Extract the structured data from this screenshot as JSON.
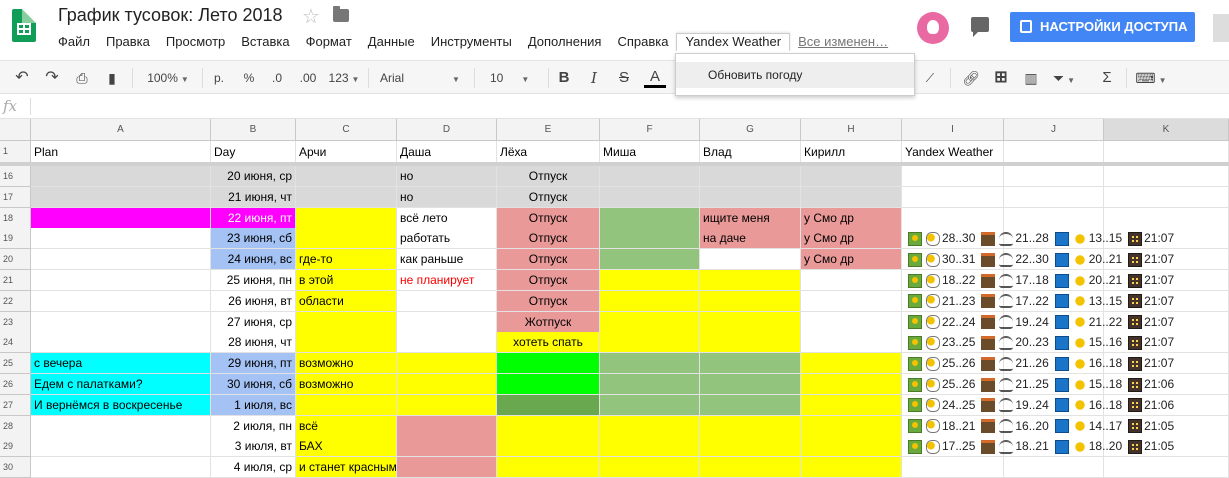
{
  "doc_title": "График тусовок: Лето 2018",
  "menu": [
    {
      "label": "Файл"
    },
    {
      "label": "Правка"
    },
    {
      "label": "Просмотр"
    },
    {
      "label": "Вставка"
    },
    {
      "label": "Формат"
    },
    {
      "label": "Данные"
    },
    {
      "label": "Инструменты"
    },
    {
      "label": "Дополнения"
    },
    {
      "label": "Справка"
    },
    {
      "label": "Yandex Weather"
    },
    {
      "label": "Все изменен…"
    }
  ],
  "share_label": "НАСТРОЙКИ ДОСТУПА",
  "dropdown_item": "Обновить погоду",
  "toolbar": {
    "zoom": "100%",
    "currency": "р.",
    "percent": "%",
    "dec_less": ".0",
    "dec_more": ".00",
    "format": "123",
    "font": "Arial",
    "font_size": "10",
    "bold": "B",
    "italic": "I",
    "strike": "S",
    "text_color": "A"
  },
  "formula_icon": "fx",
  "columns": [
    "A",
    "B",
    "C",
    "D",
    "E",
    "F",
    "G",
    "H",
    "I",
    "J",
    "K"
  ],
  "header_row": {
    "num": "1",
    "cells": [
      "Plan",
      "Day",
      "Арчи",
      "Даша",
      "Лёха",
      "Миша",
      "Влад",
      "Кирилл",
      "Yandex Weather",
      "",
      ""
    ]
  },
  "rows": [
    {
      "num": "16",
      "cells": [
        "",
        "20 июня, ср",
        "",
        "но",
        "Отпуск",
        "",
        "",
        "",
        ""
      ]
    },
    {
      "num": "17",
      "cells": [
        "",
        "21 июня, чт",
        "",
        "но",
        "Отпуск",
        "",
        "",
        "",
        ""
      ]
    },
    {
      "num": "18",
      "cells": [
        "",
        "22 июня, пт",
        "",
        "всё лето",
        "Отпуск",
        "",
        "ищите меня",
        "у Смо др",
        ""
      ]
    },
    {
      "num": "19",
      "cells": [
        "",
        "23 июня, сб",
        "",
        "работать",
        "Отпуск",
        "",
        "на даче",
        "у Смо др",
        ""
      ]
    },
    {
      "num": "20",
      "cells": [
        "",
        "24 июня, вс",
        "где-то",
        "как раньше",
        "Отпуск",
        "",
        "",
        "у Смо др",
        ""
      ]
    },
    {
      "num": "21",
      "cells": [
        "",
        "25 июня, пн",
        "в этой",
        "не планирует",
        "Отпуск",
        "",
        "",
        "",
        ""
      ]
    },
    {
      "num": "22",
      "cells": [
        "",
        "26 июня, вт",
        "области",
        "",
        "Отпуск",
        "",
        "",
        "",
        ""
      ]
    },
    {
      "num": "23",
      "cells": [
        "",
        "27 июня, ср",
        "",
        "",
        "Жотпуск",
        "",
        "",
        "",
        ""
      ]
    },
    {
      "num": "24",
      "cells": [
        "",
        "28 июня, чт",
        "",
        "",
        "хотеть спать",
        "",
        "",
        "",
        ""
      ]
    },
    {
      "num": "25",
      "cells": [
        "с вечера",
        "29 июня, пт",
        "возможно",
        "",
        "",
        "",
        "",
        "",
        ""
      ]
    },
    {
      "num": "26",
      "cells": [
        "Едем с палатками?",
        "30 июня, сб",
        "возможно",
        "",
        "",
        "",
        "",
        "",
        ""
      ]
    },
    {
      "num": "27",
      "cells": [
        "И вернёмся в воскресенье",
        "1 июля, вс",
        "",
        "",
        "",
        "",
        "",
        "",
        ""
      ]
    },
    {
      "num": "28",
      "cells": [
        "",
        "2 июля, пн",
        "всё",
        "",
        "",
        "",
        "",
        "",
        ""
      ]
    },
    {
      "num": "29",
      "cells": [
        "",
        "3 июля, вт",
        "БАХ",
        "",
        "",
        "",
        "",
        "",
        ""
      ]
    },
    {
      "num": "30",
      "cells": [
        "",
        "4 июля, ср",
        "и станет красным",
        "",
        "",
        "",
        "",
        "",
        ""
      ]
    }
  ],
  "weather": [
    {
      "row": "19",
      "t1": "28..30",
      "t2": "21..28",
      "t3": "13..15",
      "time": "21:07"
    },
    {
      "row": "20",
      "t1": "30..31",
      "t2": "22..30",
      "t3": "20..21",
      "time": "21:07"
    },
    {
      "row": "21",
      "t1": "18..22",
      "t2": "17..18",
      "t3": "20..21",
      "time": "21:07"
    },
    {
      "row": "22",
      "t1": "21..23",
      "t2": "17..22",
      "t3": "13..15",
      "time": "21:07"
    },
    {
      "row": "23",
      "t1": "22..24",
      "t2": "19..24",
      "t3": "21..22",
      "time": "21:07"
    },
    {
      "row": "24",
      "t1": "23..25",
      "t2": "20..23",
      "t3": "15..16",
      "time": "21:07"
    },
    {
      "row": "25",
      "t1": "25..26",
      "t2": "21..26",
      "t3": "16..18",
      "time": "21:07"
    },
    {
      "row": "26",
      "t1": "25..26",
      "t2": "21..25",
      "t3": "15..18",
      "time": "21:06"
    },
    {
      "row": "27",
      "t1": "24..25",
      "t2": "19..24",
      "t3": "16..18",
      "time": "21:06"
    },
    {
      "row": "28",
      "t1": "18..21",
      "t2": "16..20",
      "t3": "14..17",
      "time": "21:05"
    },
    {
      "row": "29",
      "t1": "17..25",
      "t2": "18..21",
      "t3": "18..20",
      "time": "21:05"
    }
  ],
  "colors": {
    "accent": "#4285f4",
    "sheets_green": "#0f9d58",
    "gray": "#d9d9d9",
    "magenta": "#ff00ff",
    "cyan": "#00ffff",
    "yellow": "#ffff00",
    "pink": "#ea9999",
    "green": "#93c47d",
    "bright_green": "#00ff00",
    "dark_green": "#6aa84f",
    "blue": "#a4c2f4",
    "red_text": "#ff0000"
  }
}
